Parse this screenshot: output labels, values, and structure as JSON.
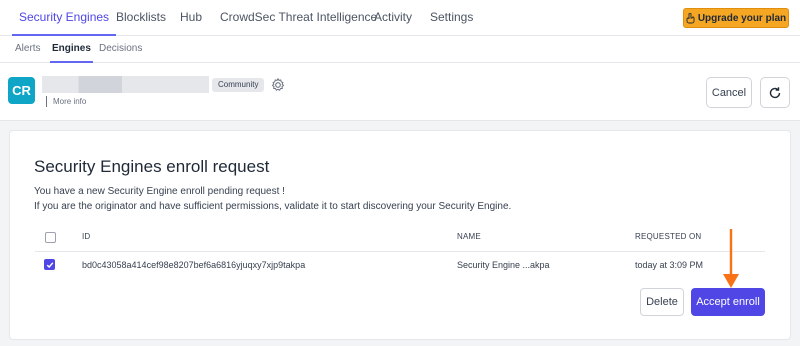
{
  "topnav": {
    "tabs": [
      {
        "label": "Security Engines",
        "active": true
      },
      {
        "label": "Blocklists"
      },
      {
        "label": "Hub"
      },
      {
        "label": "CrowdSec Threat Intelligence"
      },
      {
        "label": "Activity"
      },
      {
        "label": "Settings"
      }
    ],
    "upgrade_label": "Upgrade your plan",
    "upgrade_icon": "hand-pointer-icon"
  },
  "subnav": {
    "tabs": [
      {
        "label": "Alerts"
      },
      {
        "label": "Engines",
        "active": true
      },
      {
        "label": "Decisions"
      }
    ]
  },
  "header": {
    "avatar_initials": "CR",
    "badge": "Community",
    "more_info": "More info",
    "cancel_label": "Cancel",
    "refresh_icon": "refresh-icon"
  },
  "enroll": {
    "title": "Security Engines enroll request",
    "line1": "You have a new Security Engine enroll pending request !",
    "line2": "If you are the originator and have sufficient permissions, validate it to start discovering your Security Engine.",
    "columns": {
      "id": "ID",
      "name": "NAME",
      "requested_on": "REQUESTED ON"
    },
    "rows": [
      {
        "checked": true,
        "id": "bd0c43058a414cef98e8207bef6a6816yjuqxy7xjp9takpa",
        "name": "Security Engine ...akpa",
        "requested_on": "today at 3:09 PM"
      }
    ],
    "delete_label": "Delete",
    "accept_label": "Accept enroll"
  },
  "colors": {
    "accent": "#4f46e5",
    "upgrade": "#f5a623",
    "arrow": "#f97316",
    "avatar": "#0ea5c6"
  }
}
